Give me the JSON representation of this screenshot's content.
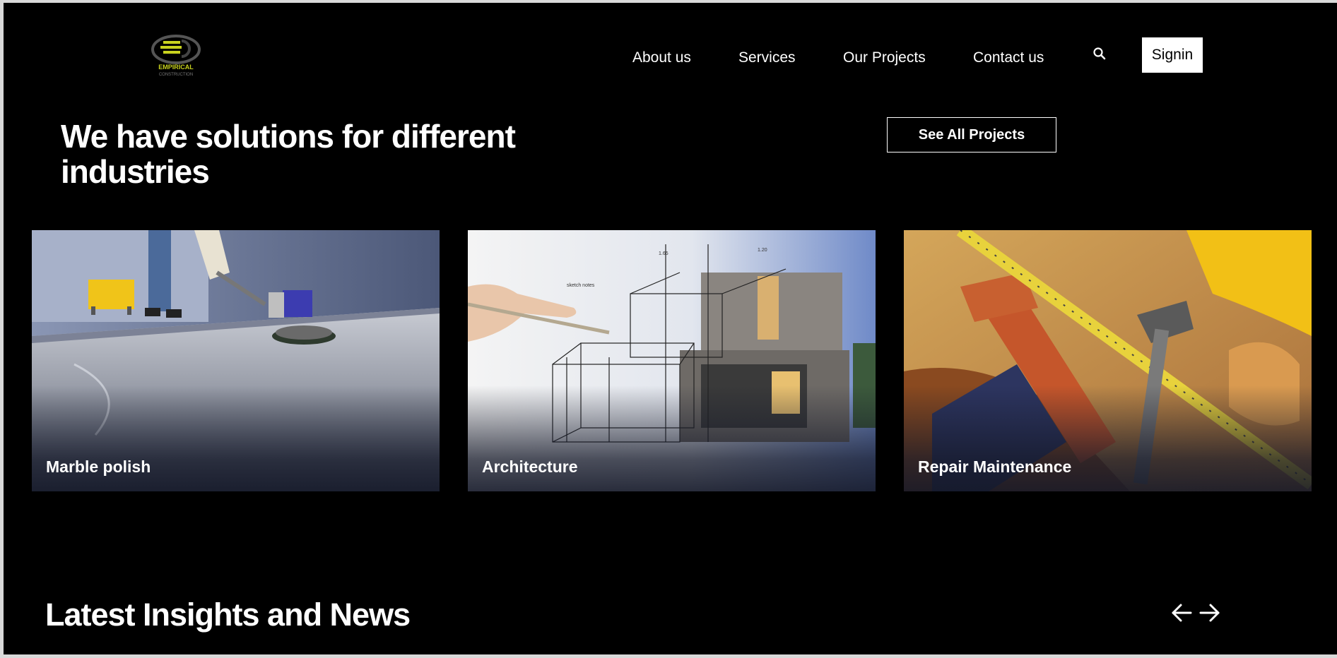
{
  "brand": {
    "logo_text": "EMPIRICAL",
    "logo_subtext": "CONSTRUCTION",
    "accent": "#c8d21e"
  },
  "nav": {
    "items": [
      {
        "label": "About us"
      },
      {
        "label": "Services"
      },
      {
        "label": "Our Projects"
      },
      {
        "label": "Contact us"
      }
    ],
    "search_icon": "search-icon",
    "signin_label": "Signin"
  },
  "solutions": {
    "title": "We have solutions for different industries",
    "see_all_label": "See All Projects",
    "cards": [
      {
        "label": "Marble polish",
        "image": "floor-polishing-photo"
      },
      {
        "label": "Architecture",
        "image": "architecture-sketch-photo"
      },
      {
        "label": "Repair Maintenance",
        "image": "tools-toolbelt-photo"
      }
    ]
  },
  "news": {
    "title": "Latest Insights and News",
    "prev_icon": "arrow-left-icon",
    "next_icon": "arrow-right-icon"
  },
  "colors": {
    "background": "#000000",
    "text": "#ffffff",
    "button_bg": "#ffffff"
  }
}
